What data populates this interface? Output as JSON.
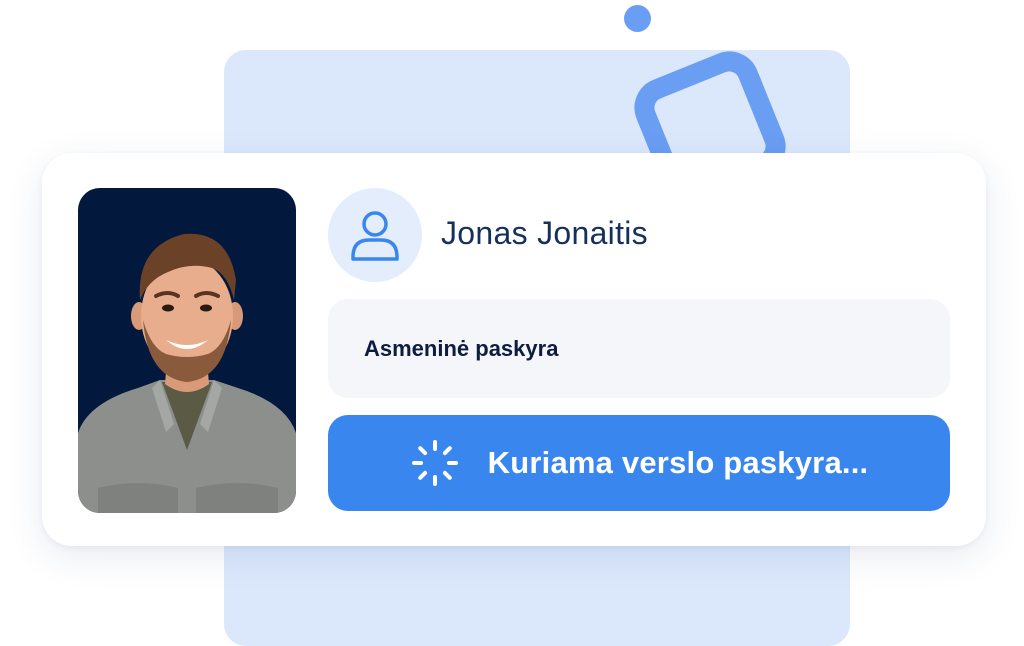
{
  "profile": {
    "name": "Jonas Jonaitis",
    "account_type": "Asmeninė paskyra"
  },
  "action": {
    "label": "Kuriama verslo paskyra..."
  },
  "icons": {
    "user": "user-icon",
    "loading": "spinner-icon"
  },
  "colors": {
    "accent": "#3a86ef",
    "name_text": "#16305e",
    "photo_bg": "#03183d",
    "panel_bg": "#dbe8fc"
  }
}
